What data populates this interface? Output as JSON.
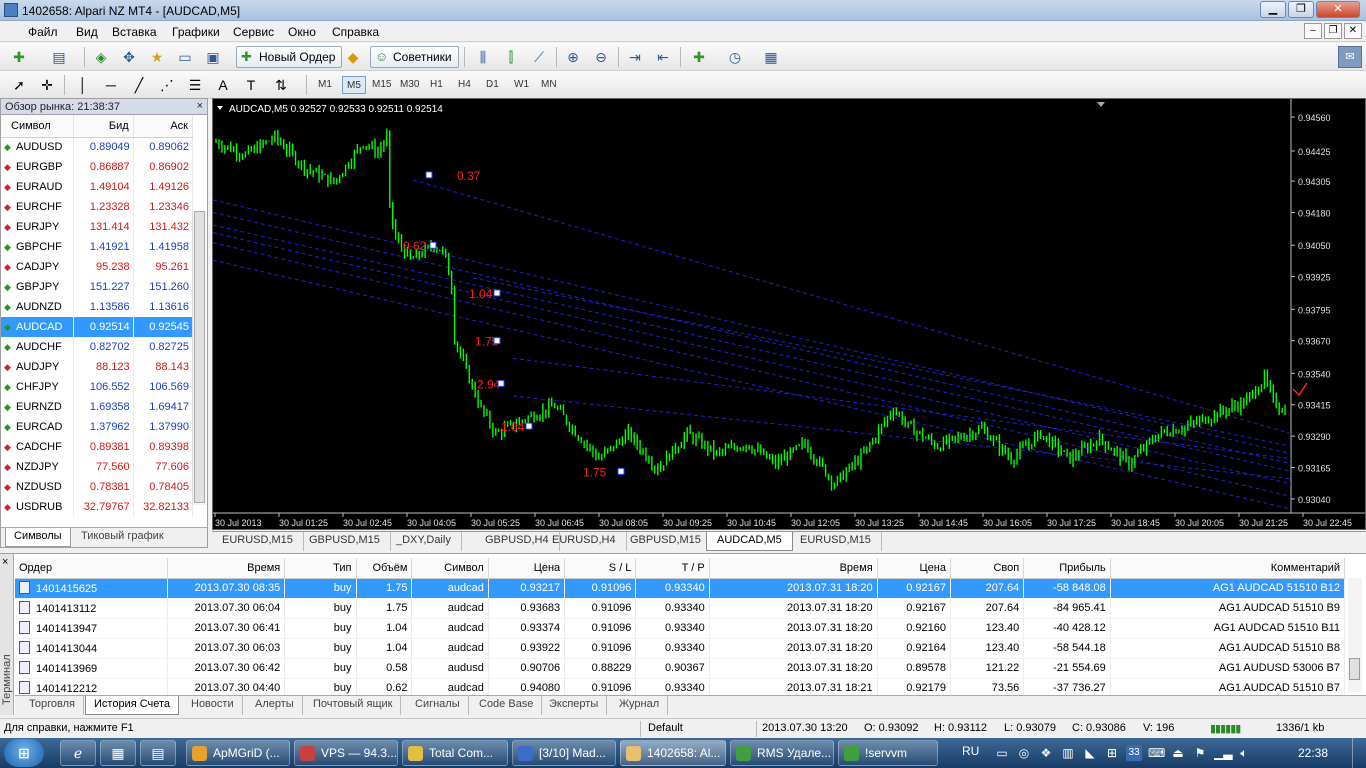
{
  "window": {
    "title": "1402658: Alpari NZ MT4 - [AUDCAD,M5]",
    "min": "▁",
    "max": "❐",
    "close": "✕"
  },
  "menu": [
    "Файл",
    "Вид",
    "Вставка",
    "Графики",
    "Сервис",
    "Окно",
    "Справка"
  ],
  "mdi": {
    "min": "‒",
    "restore": "❐",
    "close": "✕"
  },
  "toolbar": {
    "new_order": "Новый Ордер",
    "experts": "Советники",
    "timeframes": [
      "M1",
      "M5",
      "M15",
      "M30",
      "H1",
      "H4",
      "D1",
      "W1",
      "MN"
    ],
    "active_tf": "M5",
    "label_a": "A",
    "label_t": "T"
  },
  "market_watch": {
    "title": "Обзор рынка: 21:38:37",
    "close": "×",
    "columns": [
      "Символ",
      "Бид",
      "Аск"
    ],
    "rows": [
      {
        "s": "AUDUSD",
        "b": "0.89049",
        "a": "0.89062",
        "d": "up"
      },
      {
        "s": "EURGBP",
        "b": "0.86887",
        "a": "0.86902",
        "d": "dn"
      },
      {
        "s": "EURAUD",
        "b": "1.49104",
        "a": "1.49126",
        "d": "dn"
      },
      {
        "s": "EURCHF",
        "b": "1.23328",
        "a": "1.23346",
        "d": "dn"
      },
      {
        "s": "EURJPY",
        "b": "131.414",
        "a": "131.432",
        "d": "dn"
      },
      {
        "s": "GBPCHF",
        "b": "1.41921",
        "a": "1.41958",
        "d": "up"
      },
      {
        "s": "CADJPY",
        "b": "95.238",
        "a": "95.261",
        "d": "dn"
      },
      {
        "s": "GBPJPY",
        "b": "151.227",
        "a": "151.260",
        "d": "up"
      },
      {
        "s": "AUDNZD",
        "b": "1.13586",
        "a": "1.13616",
        "d": "up"
      },
      {
        "s": "AUDCAD",
        "b": "0.92514",
        "a": "0.92545",
        "d": "up",
        "sel": true
      },
      {
        "s": "AUDCHF",
        "b": "0.82702",
        "a": "0.82725",
        "d": "up"
      },
      {
        "s": "AUDJPY",
        "b": "88.123",
        "a": "88.143",
        "d": "dn"
      },
      {
        "s": "CHFJPY",
        "b": "106.552",
        "a": "106.569",
        "d": "up"
      },
      {
        "s": "EURNZD",
        "b": "1.69358",
        "a": "1.69417",
        "d": "up"
      },
      {
        "s": "EURCAD",
        "b": "1.37962",
        "a": "1.37990",
        "d": "up"
      },
      {
        "s": "CADCHF",
        "b": "0.89381",
        "a": "0.89398",
        "d": "dn"
      },
      {
        "s": "NZDJPY",
        "b": "77.560",
        "a": "77.606",
        "d": "dn"
      },
      {
        "s": "NZDUSD",
        "b": "0.78381",
        "a": "0.78405",
        "d": "dn"
      },
      {
        "s": "USDRUB",
        "b": "32.79767",
        "a": "32.82133",
        "d": "dn"
      }
    ],
    "tabs": [
      "Символы",
      "Тиковый график"
    ]
  },
  "chart_data": {
    "type": "candlestick",
    "header": "AUDCAD,M5  0.92527 0.92533 0.92511 0.92514",
    "title": "AUDCAD,M5",
    "ohlc_header": "0.92527 0.92533 0.92511 0.92514",
    "y_ticks": [
      "0.94560",
      "0.94425",
      "0.94305",
      "0.94180",
      "0.94050",
      "0.93925",
      "0.93795",
      "0.93670",
      "0.93540",
      "0.93415",
      "0.93290",
      "0.93165",
      "0.93040"
    ],
    "ylim": [
      0.93,
      0.946
    ],
    "x_ticks": [
      "30 Jul 2013",
      "30 Jul 01:25",
      "30 Jul 02:45",
      "30 Jul 04:05",
      "30 Jul 05:25",
      "30 Jul 06:45",
      "30 Jul 08:05",
      "30 Jul 09:25",
      "30 Jul 10:45",
      "30 Jul 12:05",
      "30 Jul 13:25",
      "30 Jul 14:45",
      "30 Jul 16:05",
      "30 Jul 17:25",
      "30 Jul 18:45",
      "30 Jul 20:05",
      "30 Jul 21:25",
      "30 Jul 22:45"
    ],
    "price_path": [
      [
        0,
        0.9446
      ],
      [
        20,
        0.9441
      ],
      [
        40,
        0.9448
      ],
      [
        60,
        0.9436
      ],
      [
        80,
        0.943
      ],
      [
        100,
        0.9446
      ],
      [
        110,
        0.9442
      ],
      [
        116,
        0.9448
      ],
      [
        118,
        0.942
      ],
      [
        122,
        0.9408
      ],
      [
        132,
        0.9399
      ],
      [
        148,
        0.9405
      ],
      [
        155,
        0.9402
      ],
      [
        160,
        0.9389
      ],
      [
        162,
        0.9368
      ],
      [
        170,
        0.9355
      ],
      [
        180,
        0.934
      ],
      [
        190,
        0.933
      ],
      [
        210,
        0.9336
      ],
      [
        230,
        0.9341
      ],
      [
        245,
        0.933
      ],
      [
        260,
        0.932
      ],
      [
        280,
        0.933
      ],
      [
        300,
        0.9316
      ],
      [
        320,
        0.933
      ],
      [
        340,
        0.9322
      ],
      [
        360,
        0.9326
      ],
      [
        380,
        0.9318
      ],
      [
        400,
        0.9326
      ],
      [
        420,
        0.931
      ],
      [
        440,
        0.9322
      ],
      [
        460,
        0.934
      ],
      [
        470,
        0.9333
      ],
      [
        490,
        0.9325
      ],
      [
        520,
        0.9332
      ],
      [
        540,
        0.932
      ],
      [
        560,
        0.933
      ],
      [
        580,
        0.932
      ],
      [
        600,
        0.9328
      ],
      [
        620,
        0.9318
      ],
      [
        640,
        0.933
      ],
      [
        660,
        0.9333
      ],
      [
        680,
        0.9338
      ],
      [
        700,
        0.9343
      ],
      [
        712,
        0.9352
      ],
      [
        718,
        0.9343
      ],
      [
        728,
        0.9338
      ]
    ],
    "order_labels": [
      {
        "t": "0.37",
        "x": 0.37,
        "y": 0.9431
      },
      {
        "t": "0.62",
        "x": 0.62,
        "y": 0.9403
      },
      {
        "t": "1.04",
        "x": 1.04,
        "y": 0.9384
      },
      {
        "t": "1.75",
        "x": 1.75,
        "y": 0.9365
      },
      {
        "t": "2.94",
        "x": 2.94,
        "y": 0.9348
      },
      {
        "t": "1.04",
        "x": 1.04,
        "y": 0.9331
      },
      {
        "t": "1.75",
        "x": 1.75,
        "y": 0.9313
      }
    ],
    "line_color": "#00ff00",
    "bg": "#000000",
    "trend_color": "#2020d0",
    "label_color": "#ff2020"
  },
  "chart_tabs": [
    "EURUSD,M15",
    "GBPUSD,M15",
    "_DXY,Daily",
    "GBPUSD,H4",
    "EURUSD,H4",
    "GBPUSD,M15",
    "AUDCAD,M5",
    "EURUSD,M15"
  ],
  "active_chart_tab": 6,
  "terminal": {
    "close": "×",
    "side_label": "Терминал",
    "columns": [
      "Ордер",
      "Время",
      "Тип",
      "Объём",
      "Символ",
      "Цена",
      "S / L",
      "T / P",
      "Время",
      "Цена",
      "Своп",
      "Прибыль",
      "Комментарий"
    ],
    "rows": [
      [
        "1401415625",
        "2013.07.30 08:35",
        "buy",
        "1.75",
        "audcad",
        "0.93217",
        "0.91096",
        "0.93340",
        "2013.07.31 18:20",
        "0.92167",
        "207.64",
        "-58 848.08",
        "AG1 AUDCAD 51510 B12"
      ],
      [
        "1401413112",
        "2013.07.30 06:04",
        "buy",
        "1.75",
        "audcad",
        "0.93683",
        "0.91096",
        "0.93340",
        "2013.07.31 18:20",
        "0.92167",
        "207.64",
        "-84 965.41",
        "AG1 AUDCAD 51510 B9"
      ],
      [
        "1401413947",
        "2013.07.30 06:41",
        "buy",
        "1.04",
        "audcad",
        "0.93374",
        "0.91096",
        "0.93340",
        "2013.07.31 18:20",
        "0.92160",
        "123.40",
        "-40 428.12",
        "AG1 AUDCAD 51510 B11"
      ],
      [
        "1401413044",
        "2013.07.30 06:03",
        "buy",
        "1.04",
        "audcad",
        "0.93922",
        "0.91096",
        "0.93340",
        "2013.07.31 18:20",
        "0.92164",
        "123.40",
        "-58 544.18",
        "AG1 AUDCAD 51510 B8"
      ],
      [
        "1401413969",
        "2013.07.30 06:42",
        "buy",
        "0.58",
        "audusd",
        "0.90706",
        "0.88229",
        "0.90367",
        "2013.07.31 18:20",
        "0.89578",
        "121.22",
        "-21 554.69",
        "AG1 AUDUSD 53006 B7"
      ],
      [
        "1401412212",
        "2013.07.30 04:40",
        "buy",
        "0.62",
        "audcad",
        "0.94080",
        "0.91096",
        "0.93340",
        "2013.07.31 18:21",
        "0.92179",
        "73.56",
        "-37 736.27",
        "AG1 AUDCAD 51510 B7"
      ]
    ],
    "tabs": [
      "Торговля",
      "История Счета",
      "Новости",
      "Алерты",
      "Почтовый ящик",
      "Сигналы",
      "Code Base",
      "Эксперты",
      "Журнал"
    ],
    "active_tab": 1
  },
  "status": {
    "help": "Для справки, нажмите F1",
    "profile": "Default",
    "time": "2013.07.30 13:20",
    "o": "O: 0.93092",
    "h": "H: 0.93112",
    "l": "L: 0.93079",
    "c": "C: 0.93086",
    "v": "V: 196",
    "traffic": "1336/1 kb"
  },
  "taskbar": {
    "start": "⊞",
    "items": [
      {
        "l": "ApMGriD (...",
        "c": "#e8a030"
      },
      {
        "l": "VPS — 94.3...",
        "c": "#c84040"
      },
      {
        "l": "Total Com...",
        "c": "#e0c040"
      },
      {
        "l": "[3/10] Mad...",
        "c": "#3c6ec8"
      },
      {
        "l": "1402658: Al...",
        "c": "#e8c070",
        "on": true
      },
      {
        "l": "RMS Удале...",
        "c": "#40a040"
      },
      {
        "l": "!servvm",
        "c": "#40a040"
      }
    ],
    "lang": "RU",
    "clock": "22:38",
    "tray_badge": "33"
  }
}
